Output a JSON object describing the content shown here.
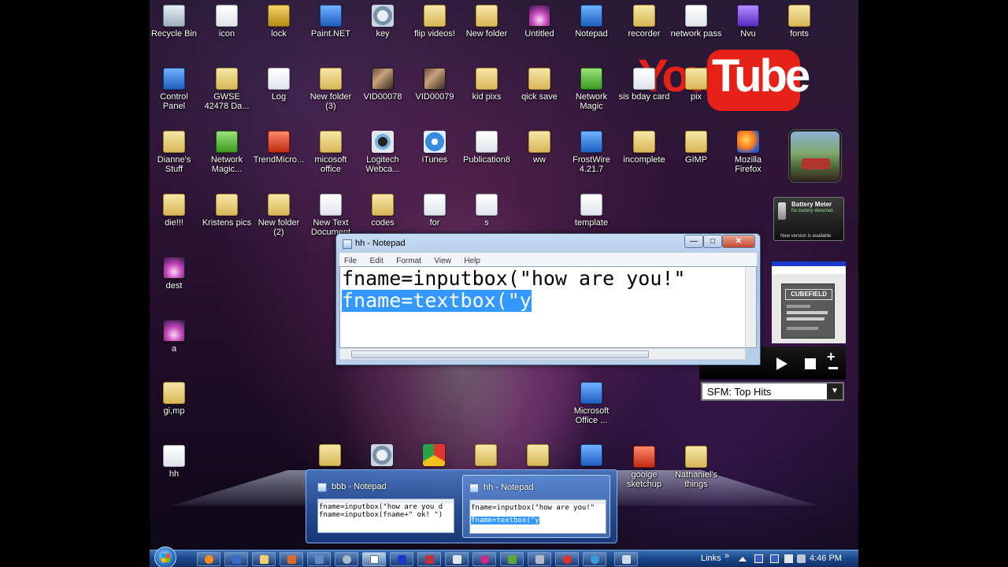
{
  "desktop": {
    "icons": [
      {
        "label": "Recycle Bin",
        "icon": "recycle-bin-icon"
      },
      {
        "label": "icon",
        "icon": "file-icon"
      },
      {
        "label": "lock",
        "icon": "lock-icon"
      },
      {
        "label": "Paint.NET",
        "icon": "paint-net-icon"
      },
      {
        "label": "key",
        "icon": "key-icon"
      },
      {
        "label": "flip videos!",
        "icon": "folder-icon"
      },
      {
        "label": "New folder",
        "icon": "folder-icon"
      },
      {
        "label": "Untitled",
        "icon": "image-icon"
      },
      {
        "label": "Notepad",
        "icon": "notepad-icon"
      },
      {
        "label": "recorder",
        "icon": "folder-icon"
      },
      {
        "label": "network pass",
        "icon": "document-icon"
      },
      {
        "label": "Nvu",
        "icon": "nvu-icon"
      },
      {
        "label": "fonts",
        "icon": "folder-icon"
      },
      {
        "label": "Control Panel",
        "icon": "control-panel-icon"
      },
      {
        "label": "GWSE 42478 Da...",
        "icon": "folder-icon"
      },
      {
        "label": "Log",
        "icon": "file-icon"
      },
      {
        "label": "New folder (3)",
        "icon": "folder-icon"
      },
      {
        "label": "VID00078",
        "icon": "video-icon"
      },
      {
        "label": "VID00079",
        "icon": "video-icon"
      },
      {
        "label": "kid pixs",
        "icon": "folder-icon"
      },
      {
        "label": "qick save",
        "icon": "folder-icon"
      },
      {
        "label": "Network Magic",
        "icon": "network-magic-icon"
      },
      {
        "label": "sis bday card",
        "icon": "document-icon"
      },
      {
        "label": "pix",
        "icon": "folder-icon"
      },
      {
        "label": "Dianne's Stuff",
        "icon": "folder-icon"
      },
      {
        "label": "Network Magic...",
        "icon": "network-magic-icon"
      },
      {
        "label": "TrendMicro...",
        "icon": "trendmicro-icon"
      },
      {
        "label": "micosoft office",
        "icon": "folder-icon"
      },
      {
        "label": "Logitech Webca...",
        "icon": "webcam-icon"
      },
      {
        "label": "iTunes",
        "icon": "itunes-icon"
      },
      {
        "label": "Publication8",
        "icon": "document-icon"
      },
      {
        "label": "ww",
        "icon": "folder-icon"
      },
      {
        "label": "FrostWire 4.21.7",
        "icon": "frostwire-icon"
      },
      {
        "label": "incomplete",
        "icon": "folder-icon"
      },
      {
        "label": "GIMP",
        "icon": "folder-icon"
      },
      {
        "label": "Mozilla Firefox",
        "icon": "firefox-icon"
      },
      {
        "label": "die!!!",
        "icon": "folder-icon"
      },
      {
        "label": "Kristens pics",
        "icon": "folder-icon"
      },
      {
        "label": "New folder (2)",
        "icon": "folder-icon"
      },
      {
        "label": "New Text Document",
        "icon": "file-icon"
      },
      {
        "label": "codes",
        "icon": "folder-icon"
      },
      {
        "label": "for",
        "icon": "file-icon"
      },
      {
        "label": "s",
        "icon": "script-icon"
      },
      {
        "label": "template",
        "icon": "file-icon"
      },
      {
        "label": "dest",
        "icon": "image-icon"
      },
      {
        "label": "a",
        "icon": "image-icon"
      },
      {
        "label": "gi,mp",
        "icon": "folder-icon"
      },
      {
        "label": "Microsoft Office ...",
        "icon": "office-icon"
      },
      {
        "label": "hh",
        "icon": "script-icon"
      },
      {
        "label": "goolge sketchup",
        "icon": "sketchup-icon"
      },
      {
        "label": "Nathaniel's things",
        "icon": "folder-icon"
      }
    ],
    "youtube_logo": {
      "you": "You",
      "tube": "Tube"
    }
  },
  "gadgets": {
    "battery": {
      "title": "Battery Meter",
      "status": "No battery detected.",
      "footer": "New version is available"
    },
    "game": {
      "title": "CUBEFIELD"
    },
    "media": {
      "station": "SFM: Top Hits"
    }
  },
  "notepad": {
    "title": "hh - Notepad",
    "menu": [
      "File",
      "Edit",
      "Format",
      "View",
      "Help"
    ],
    "lines": [
      "fname=inputbox(\"how are you!\"",
      "fname=textbox(\"y"
    ],
    "minimize_glyph": "—",
    "maximize_glyph": "□",
    "close_glyph": "✕"
  },
  "peek": {
    "thumbnails": [
      {
        "title": "bbb - Notepad",
        "lines": [
          "fname=inputbox(\"how are you d",
          "fname=inputbox(fname+\" ok! \")"
        ]
      },
      {
        "title": "hh - Notepad",
        "lines": [
          "fname=inputbox(\"how are you!\"",
          "fname=textbox(\"y"
        ]
      }
    ]
  },
  "taskbar": {
    "links_label": "Links",
    "chevron": "»",
    "clock": "4:46 PM",
    "colors": {
      "start": "#2a72c8",
      "bar": "#1d4a8c"
    }
  }
}
